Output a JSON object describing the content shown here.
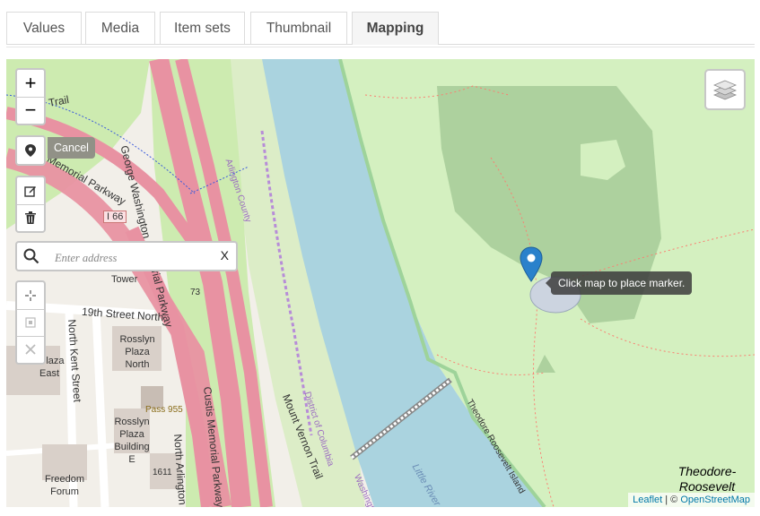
{
  "tabs": [
    {
      "label": "Values",
      "active": false
    },
    {
      "label": "Media",
      "active": false
    },
    {
      "label": "Item sets",
      "active": false
    },
    {
      "label": "Thumbnail",
      "active": false
    },
    {
      "label": "Mapping",
      "active": true
    }
  ],
  "map": {
    "zoom_in": "+",
    "zoom_out": "−",
    "cancel_label": "Cancel",
    "geocoder": {
      "placeholder": "Enter address",
      "clear_label": "X"
    },
    "tooltip": "Click map to place marker.",
    "attribution": {
      "leaflet": "Leaflet",
      "separator": " | © ",
      "osm": "OpenStreetMap"
    },
    "labels": {
      "trail": "Trail",
      "memorial_parkway": "Memorial Parkway",
      "gw_parkway": "George Washington Memorial Parkway",
      "arlington_county": "Arlington County",
      "i66": "I 66",
      "tower": "Tower",
      "nineteenth_st": "19th Street North",
      "north_kent": "North Kent Street",
      "rosslyn_plaza_north": "Rosslyn Plaza North",
      "plaza_east": "Plaza East",
      "pass_955": "Pass 955",
      "rosslyn_plaza_building": "Rosslyn Plaza Building E",
      "freedom_forum": "Freedom Forum",
      "n1611": "1611",
      "n73": "73",
      "north_arlington": "North Arlington",
      "custis": "Custis Memorial Parkway",
      "mount_vernon": "Mount Vernon Trail",
      "district_columbia": "District of Columbia",
      "washington": "Washington",
      "little_river": "Little River",
      "tr_island_road": "Theodore Roosevelt Island",
      "tr_island_title": "Theodore-Roosevelt"
    },
    "colors": {
      "water": "#aad3df",
      "park": "#cdebb0",
      "forest": "#add19e",
      "road": "#e892a2",
      "marker": "#2a81cb"
    }
  }
}
